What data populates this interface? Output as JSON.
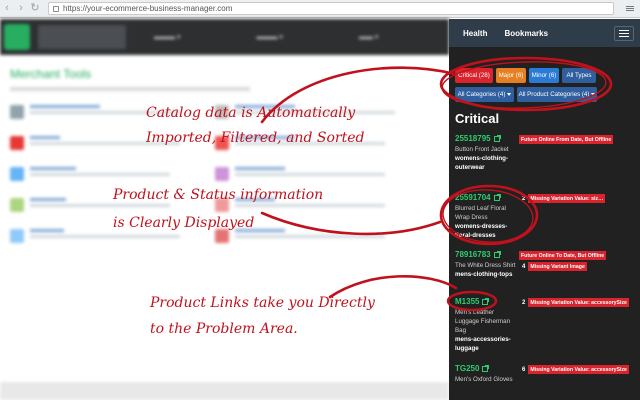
{
  "browser": {
    "url": "https://your-ecommerce-business-manager.com"
  },
  "panel": {
    "tabs": [
      "Health",
      "Bookmarks"
    ],
    "filters": {
      "critical": "Critical (28)",
      "major": "Major (6)",
      "minor": "Minor (6)",
      "all_types": "All Types",
      "all_categories": "All Categories (4)",
      "all_product_categories": "All Product Categories (4)"
    },
    "section_title": "Critical",
    "items": [
      {
        "id": "25518795",
        "name": "Button Front Jacket",
        "path": "womens-clothing-outerwear"
      },
      {
        "id": "25591704",
        "name": "Blurred Leaf Floral Wrap Dress",
        "path": "womens-dresses-floral-dresses"
      },
      {
        "id": "78916783",
        "name": "The White Dress Shirt",
        "path": "mens-clothing-tops"
      },
      {
        "id": "M1355",
        "name": "Men's Leather Luggage Fisherman Bag",
        "path": "mens-accessories-luggage"
      },
      {
        "id": "TG250",
        "name": "Men's Oxford Gloves",
        "path": ""
      }
    ],
    "issues": [
      {
        "count": "",
        "label": "Future Online From Date, But Offline"
      },
      {
        "count": "2",
        "label": "Missing Variation Value: siz…"
      },
      {
        "count": "",
        "label": "Future Online To Date, But Offline"
      },
      {
        "count": "4",
        "label": "Missing Variant Image"
      },
      {
        "count": "2",
        "label": "Missing Variation Value: accessorySize"
      },
      {
        "count": "6",
        "label": "Missing Variation Value: accessorySize"
      }
    ]
  },
  "background_app": {
    "title": "Merchant Tools"
  },
  "annotations": {
    "callout1": "Catalog data is Automatically Imported, Filtered, and Sorted",
    "callout1_line1": "Catalog data is Automatically",
    "callout1_line2": "Imported, Filtered, and Sorted",
    "callout2_line1": "Product & Status information",
    "callout2_line2": "is Clearly Displayed",
    "callout3_line1": "Product Links take you Directly",
    "callout3_line2": "to the Problem Area."
  },
  "colors": {
    "critical": "#d9232d",
    "major": "#e67e22",
    "minor": "#2b7bd6",
    "dropdown": "#2f5f9e",
    "link": "#2ecc71",
    "annotation": "#c0121c"
  }
}
